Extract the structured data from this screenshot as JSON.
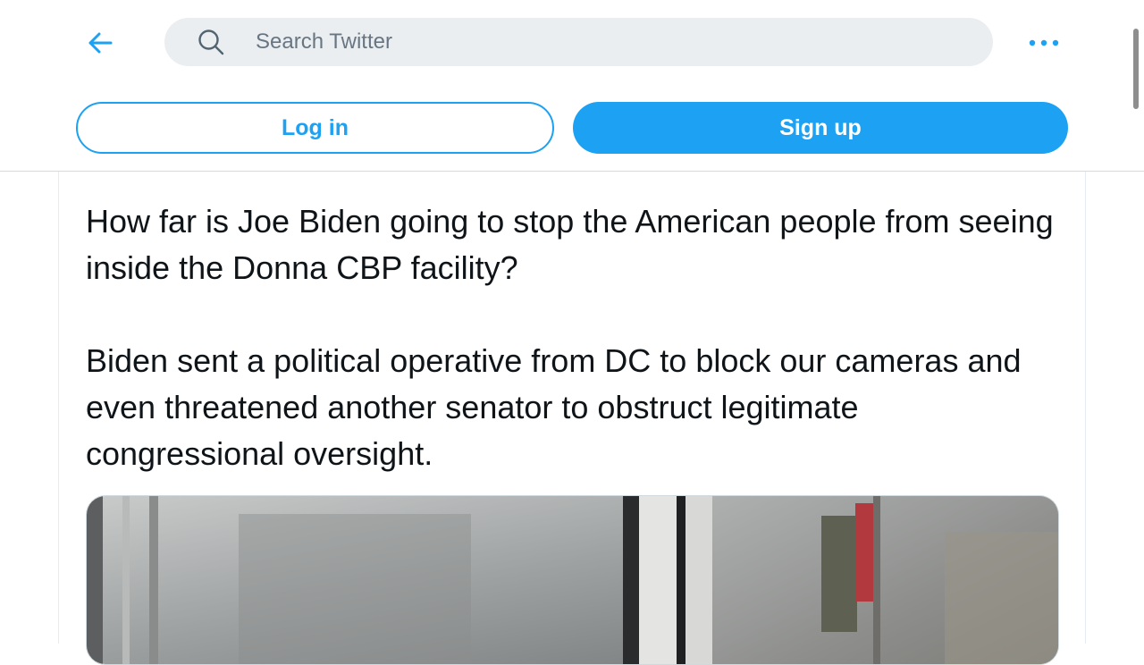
{
  "header": {
    "back_icon": "arrow-left-icon",
    "search": {
      "placeholder": "Search Twitter",
      "value": "",
      "icon": "search-icon"
    },
    "more_icon": "more-horizontal-icon"
  },
  "auth": {
    "login_label": "Log in",
    "signup_label": "Sign up"
  },
  "tweet": {
    "paragraphs": [
      "How far is Joe Biden going to stop the American people from seeing inside the Donna CBP facility?",
      "Biden sent a political operative from DC to block our cameras and even threatened another senator to obstruct legitimate congressional oversight."
    ]
  },
  "colors": {
    "accent": "#1da1f2",
    "search_bg": "#ebeef0",
    "text": "#0f1419",
    "placeholder": "#687684"
  }
}
